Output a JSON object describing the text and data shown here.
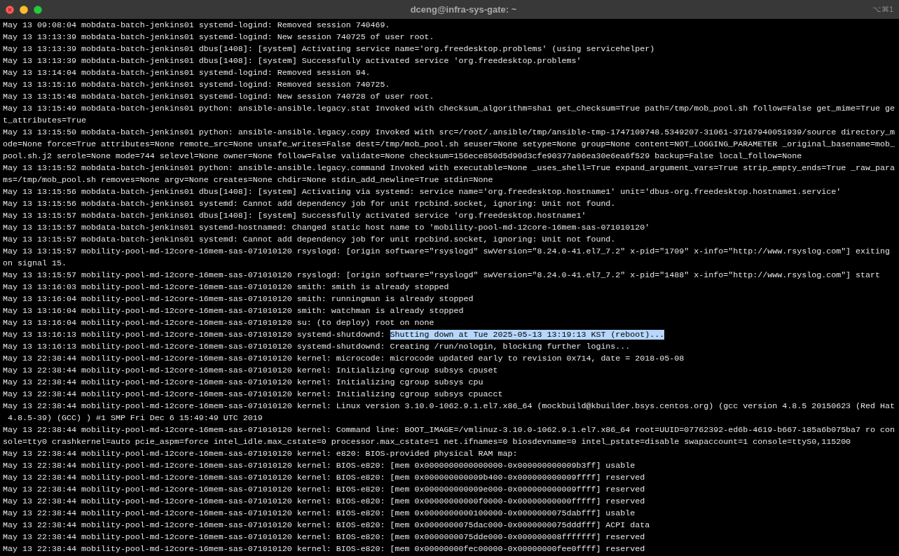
{
  "window": {
    "title": "dceng@infra-sys-gate: ~",
    "shortcut": "⌥⌘1"
  },
  "lines": [
    {
      "text": "May 13 09:08:04 mobdata-batch-jenkins01 systemd-logind: Removed session 740469."
    },
    {
      "text": "May 13 13:13:39 mobdata-batch-jenkins01 systemd-logind: New session 740725 of user root."
    },
    {
      "text": "May 13 13:13:39 mobdata-batch-jenkins01 dbus[1408]: [system] Activating service name='org.freedesktop.problems' (using servicehelper)"
    },
    {
      "text": "May 13 13:13:39 mobdata-batch-jenkins01 dbus[1408]: [system] Successfully activated service 'org.freedesktop.problems'"
    },
    {
      "text": "May 13 13:14:04 mobdata-batch-jenkins01 systemd-logind: Removed session 94."
    },
    {
      "text": "May 13 13:15:16 mobdata-batch-jenkins01 systemd-logind: Removed session 740725."
    },
    {
      "text": "May 13 13:15:48 mobdata-batch-jenkins01 systemd-logind: New session 740728 of user root."
    },
    {
      "text": "May 13 13:15:49 mobdata-batch-jenkins01 python: ansible-ansible.legacy.stat Invoked with checksum_algorithm=sha1 get_checksum=True path=/tmp/mob_pool.sh follow=False get_mime=True get_attributes=True"
    },
    {
      "text": "May 13 13:15:50 mobdata-batch-jenkins01 python: ansible-ansible.legacy.copy Invoked with src=/root/.ansible/tmp/ansible-tmp-1747109748.5349207-31061-37167940051939/source directory_mode=None force=True attributes=None remote_src=None unsafe_writes=False dest=/tmp/mob_pool.sh seuser=None setype=None group=None content=NOT_LOGGING_PARAMETER _original_basename=mob_pool.sh.j2 serole=None mode=744 selevel=None owner=None follow=False validate=None checksum=156ece850d5d90d3cfe90377a06ea30e6ea6f529 backup=False local_follow=None"
    },
    {
      "text": "May 13 13:15:52 mobdata-batch-jenkins01 python: ansible-ansible.legacy.command Invoked with executable=None _uses_shell=True expand_argument_vars=True strip_empty_ends=True _raw_params=/tmp/mob_pool.sh removes=None argv=None creates=None chdir=None stdin_add_newline=True stdin=None"
    },
    {
      "text": "May 13 13:15:56 mobdata-batch-jenkins01 dbus[1408]: [system] Activating via systemd: service name='org.freedesktop.hostname1' unit='dbus-org.freedesktop.hostname1.service'"
    },
    {
      "text": "May 13 13:15:56 mobdata-batch-jenkins01 systemd: Cannot add dependency job for unit rpcbind.socket, ignoring: Unit not found."
    },
    {
      "text": "May 13 13:15:57 mobdata-batch-jenkins01 dbus[1408]: [system] Successfully activated service 'org.freedesktop.hostname1'"
    },
    {
      "text": "May 13 13:15:57 mobdata-batch-jenkins01 systemd-hostnamed: Changed static host name to 'mobility-pool-md-12core-16mem-sas-071010120'"
    },
    {
      "text": "May 13 13:15:57 mobdata-batch-jenkins01 systemd: Cannot add dependency job for unit rpcbind.socket, ignoring: Unit not found."
    },
    {
      "text": "May 13 13:15:57 mobility-pool-md-12core-16mem-sas-071010120 rsyslogd: [origin software=\"rsyslogd\" swVersion=\"8.24.0-41.el7_7.2\" x-pid=\"1709\" x-info=\"http://www.rsyslog.com\"] exiting on signal 15."
    },
    {
      "text": "May 13 13:15:57 mobility-pool-md-12core-16mem-sas-071010120 rsyslogd: [origin software=\"rsyslogd\" swVersion=\"8.24.0-41.el7_7.2\" x-pid=\"1488\" x-info=\"http://www.rsyslog.com\"] start"
    },
    {
      "text": "May 13 13:16:03 mobility-pool-md-12core-16mem-sas-071010120 smith: smith is already stopped"
    },
    {
      "text": "May 13 13:16:04 mobility-pool-md-12core-16mem-sas-071010120 smith: runningman is already stopped"
    },
    {
      "text": "May 13 13:16:04 mobility-pool-md-12core-16mem-sas-071010120 smith: watchman is already stopped"
    },
    {
      "text": "May 13 13:16:04 mobility-pool-md-12core-16mem-sas-071010120 su: (to deploy) root on none"
    },
    {
      "text": "May 13 13:16:13 mobility-pool-md-12core-16mem-sas-071010120 systemd-shutdownd:",
      "selection": "Shutting down at Tue 2025-05-13 13:19:13 KST (reboot)..."
    },
    {
      "text": "May 13 13:16:13 mobility-pool-md-12core-16mem-sas-071010120 systemd-shutdownd: Creating /run/nologin, blocking further logins..."
    },
    {
      "text": "May 13 22:38:44 mobility-pool-md-12core-16mem-sas-071010120 kernel: microcode: microcode updated early to revision 0x714, date = 2018-05-08"
    },
    {
      "text": "May 13 22:38:44 mobility-pool-md-12core-16mem-sas-071010120 kernel: Initializing cgroup subsys cpuset"
    },
    {
      "text": "May 13 22:38:44 mobility-pool-md-12core-16mem-sas-071010120 kernel: Initializing cgroup subsys cpu"
    },
    {
      "text": "May 13 22:38:44 mobility-pool-md-12core-16mem-sas-071010120 kernel: Initializing cgroup subsys cpuacct"
    },
    {
      "text": "May 13 22:38:44 mobility-pool-md-12core-16mem-sas-071010120 kernel: Linux version 3.10.0-1062.9.1.el7.x86_64 (mockbuild@kbuilder.bsys.centos.org) (gcc version 4.8.5 20150623 (Red Hat 4.8.5-39) (GCC) ) #1 SMP Fri Dec 6 15:49:49 UTC 2019"
    },
    {
      "text": "May 13 22:38:44 mobility-pool-md-12core-16mem-sas-071010120 kernel: Command line: BOOT_IMAGE=/vmlinuz-3.10.0-1062.9.1.el7.x86_64 root=UUID=07762392-ed6b-4619-b667-185a6b075ba7 ro console=tty0 crashkernel=auto pcie_aspm=force intel_idle.max_cstate=0 processor.max_cstate=1 net.ifnames=0 biosdevname=0 intel_pstate=disable swapaccount=1 console=ttyS0,115200"
    },
    {
      "text": "May 13 22:38:44 mobility-pool-md-12core-16mem-sas-071010120 kernel: e820: BIOS-provided physical RAM map:"
    },
    {
      "text": "May 13 22:38:44 mobility-pool-md-12core-16mem-sas-071010120 kernel: BIOS-e820: [mem 0x0000000000000000-0x000000000009b3ff] usable"
    },
    {
      "text": "May 13 22:38:44 mobility-pool-md-12core-16mem-sas-071010120 kernel: BIOS-e820: [mem 0x000000000009b400-0x000000000009ffff] reserved"
    },
    {
      "text": "May 13 22:38:44 mobility-pool-md-12core-16mem-sas-071010120 kernel: BIOS-e820: [mem 0x000000000009e000-0x000000000009ffff] reserved"
    },
    {
      "text": "May 13 22:38:44 mobility-pool-md-12core-16mem-sas-071010120 kernel: BIOS-e820: [mem 0x00000000000f0000-0x00000000000fffff] reserved"
    },
    {
      "text": "May 13 22:38:44 mobility-pool-md-12core-16mem-sas-071010120 kernel: BIOS-e820: [mem 0x0000000000100000-0x0000000075dabfff] usable"
    },
    {
      "text": "May 13 22:38:44 mobility-pool-md-12core-16mem-sas-071010120 kernel: BIOS-e820: [mem 0x0000000075dac000-0x0000000075dddfff] ACPI data"
    },
    {
      "text": "May 13 22:38:44 mobility-pool-md-12core-16mem-sas-071010120 kernel: BIOS-e820: [mem 0x0000000075dde000-0x000000008fffffff] reserved"
    },
    {
      "text": "May 13 22:38:44 mobility-pool-md-12core-16mem-sas-071010120 kernel: BIOS-e820: [mem 0x00000000fec00000-0x00000000fee0ffff] reserved"
    }
  ]
}
